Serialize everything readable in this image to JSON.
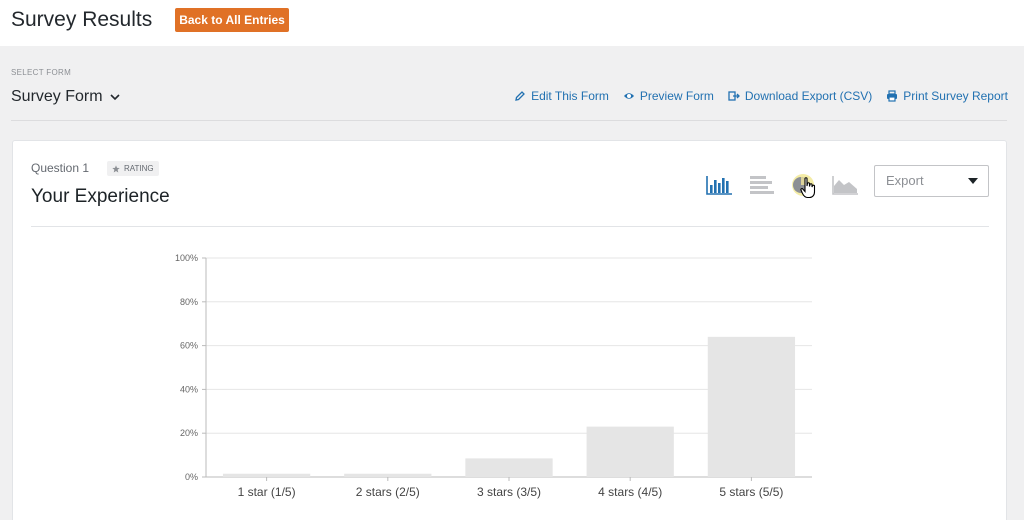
{
  "header": {
    "title": "Survey Results",
    "back_button": "Back to All Entries"
  },
  "form_selector": {
    "label": "SELECT FORM",
    "value": "Survey Form"
  },
  "actions": [
    {
      "label": "Edit This Form",
      "icon": "pencil-icon"
    },
    {
      "label": "Preview Form",
      "icon": "eye-icon"
    },
    {
      "label": "Download Export (CSV)",
      "icon": "export-icon"
    },
    {
      "label": "Print Survey Report",
      "icon": "printer-icon"
    }
  ],
  "question": {
    "number": "Question 1",
    "type_badge": "RATING",
    "title": "Your Experience"
  },
  "chart_type_buttons": [
    {
      "name": "vertical-bar",
      "active": true
    },
    {
      "name": "horizontal-bar",
      "active": false
    },
    {
      "name": "pie",
      "active": false,
      "hovered": true
    },
    {
      "name": "area",
      "active": false
    }
  ],
  "export_select": {
    "placeholder": "Export"
  },
  "colors": {
    "accent": "#e07126",
    "link": "#2271b1",
    "bar": "#e5e5e5",
    "active_icon": "#2271b1",
    "inactive_icon": "#c3c4c7"
  },
  "chart_data": {
    "type": "bar",
    "categories": [
      "1 star (1/5)",
      "2 stars (2/5)",
      "3 stars (3/5)",
      "4 stars (4/5)",
      "5 stars (5/5)"
    ],
    "values": [
      1.5,
      1.5,
      8.5,
      23,
      64
    ],
    "y_ticks": [
      "0%",
      "20%",
      "40%",
      "60%",
      "80%",
      "100%"
    ],
    "ylim": [
      0,
      100
    ],
    "grid": true
  }
}
